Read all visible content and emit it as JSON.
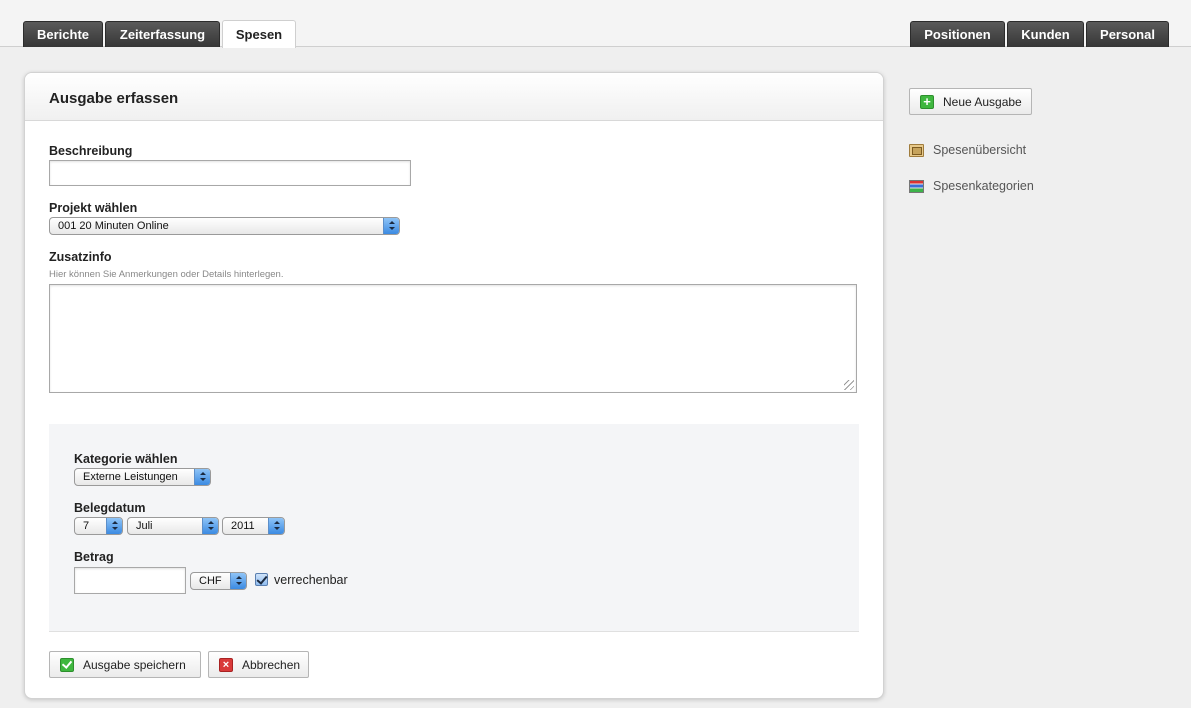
{
  "nav": {
    "left_tabs": [
      {
        "label": "Berichte",
        "active": false
      },
      {
        "label": "Zeiterfassung",
        "active": false
      },
      {
        "label": "Spesen",
        "active": true
      }
    ],
    "right_tabs": [
      {
        "label": "Positionen"
      },
      {
        "label": "Kunden"
      },
      {
        "label": "Personal"
      }
    ]
  },
  "form": {
    "title": "Ausgabe erfassen",
    "beschreibung": {
      "label": "Beschreibung",
      "value": ""
    },
    "projekt": {
      "label": "Projekt wählen",
      "selected": "001 20 Minuten Online"
    },
    "zusatzinfo": {
      "label": "Zusatzinfo",
      "hint": "Hier können Sie Anmerkungen oder Details hinterlegen.",
      "value": ""
    },
    "kategorie": {
      "label": "Kategorie wählen",
      "selected": "Externe Leistungen"
    },
    "belegdatum": {
      "label": "Belegdatum",
      "day": "7",
      "month": "Juli",
      "year": "2011"
    },
    "betrag": {
      "label": "Betrag",
      "value": "",
      "currency": "CHF",
      "billable_label": "verrechenbar",
      "billable": true
    },
    "save_label": "Ausgabe speichern",
    "cancel_label": "Abbrechen"
  },
  "sidebar": {
    "new_button": "Neue Ausgabe",
    "links": [
      {
        "label": "Spesenübersicht",
        "icon": "overview-icon"
      },
      {
        "label": "Spesenkategorien",
        "icon": "categories-icon"
      }
    ]
  },
  "colors": {
    "tab_dark": "#3c3c3c",
    "select_arrow": "#3b8ae2",
    "ok_green": "#3fb73f",
    "cancel_red": "#d93a3a"
  }
}
